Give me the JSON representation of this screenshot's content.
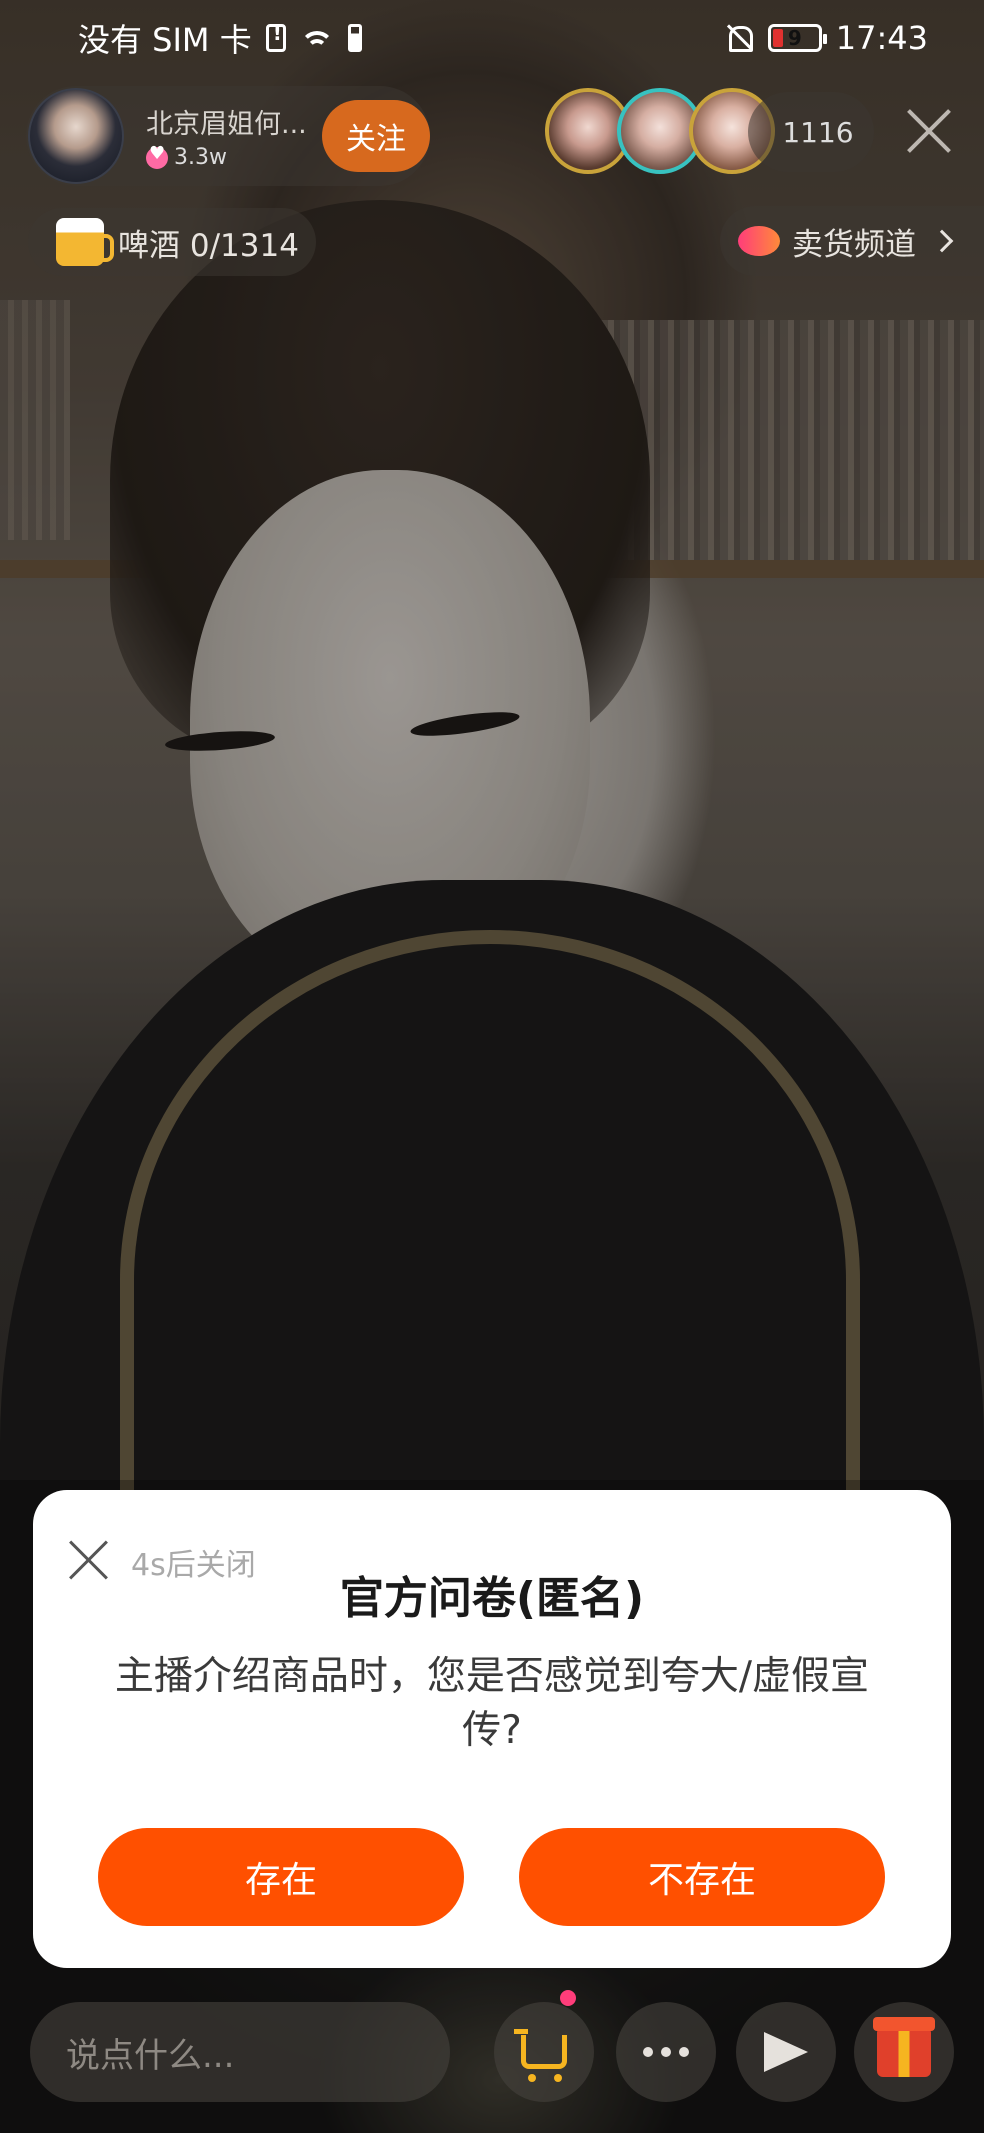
{
  "status_bar": {
    "carrier": "没有 SIM 卡",
    "battery_level": "9",
    "time": "17:43"
  },
  "host": {
    "name": "北京眉姐何...",
    "likes": "3.3w",
    "follow_label": "关注"
  },
  "viewers": {
    "count": "1116"
  },
  "badges": {
    "beer_label": "啤酒 0/1314",
    "channel_label": "卖货频道"
  },
  "survey": {
    "countdown": "4s后关闭",
    "title": "官方问卷(匿名)",
    "question": "主播介绍商品时，您是否感觉到夸大/虚假宣传?",
    "yes_label": "存在",
    "no_label": "不存在"
  },
  "bottom_bar": {
    "comment_placeholder": "说点什么..."
  },
  "colors": {
    "accent": "#ff5000",
    "follow": "#d7691e",
    "cart": "#f6b520"
  }
}
